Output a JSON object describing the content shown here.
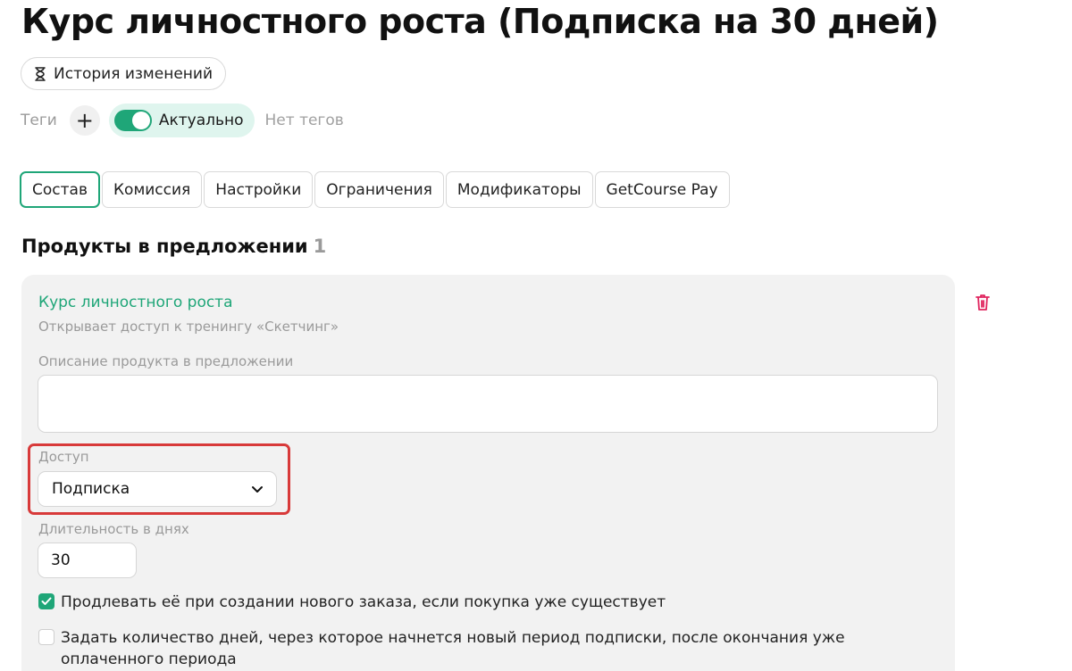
{
  "page": {
    "title": "Курс личностного роста (Подписка на 30 дней)"
  },
  "history_button": {
    "label": "История изменений",
    "icon": "hourglass-icon"
  },
  "tags": {
    "label": "Теги",
    "add_label": "+",
    "status_label": "Актуально",
    "status_on": true,
    "empty_text": "Нет тегов"
  },
  "tabs": [
    {
      "label": "Состав",
      "active": true
    },
    {
      "label": "Комиссия",
      "active": false
    },
    {
      "label": "Настройки",
      "active": false
    },
    {
      "label": "Ограничения",
      "active": false
    },
    {
      "label": "Модификаторы",
      "active": false
    },
    {
      "label": "GetCourse Pay",
      "active": false
    }
  ],
  "section": {
    "title": "Продукты в предложении",
    "count": "1"
  },
  "product": {
    "name": "Курс личностного роста",
    "subtitle": "Открывает доступ к тренингу «Скетчинг»",
    "description_label": "Описание продукта в предложении",
    "description_value": "",
    "access_label": "Доступ",
    "access_value": "Подписка",
    "duration_label": "Длительность в днях",
    "duration_value": "30",
    "extend_checkbox": {
      "checked": true,
      "label": "Продлевать её при создании нового заказа, если покупка уже существует"
    },
    "delay_checkbox": {
      "checked": false,
      "label": "Задать количество дней, через которое начнется новый период подписки, после окончания уже оплаченного периода"
    }
  },
  "colors": {
    "accent": "#1fa678",
    "highlight": "#d83a3a",
    "delete": "#e0245e",
    "muted": "#9a9a9a"
  }
}
